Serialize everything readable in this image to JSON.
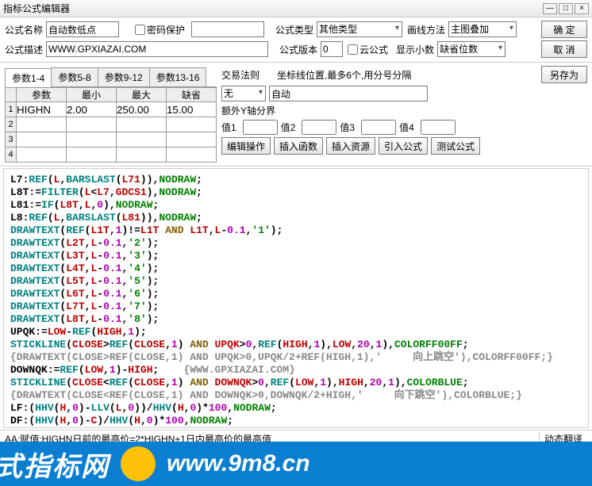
{
  "window": {
    "title": "指标公式编辑器",
    "min": "—",
    "max": "□",
    "close": "×"
  },
  "form": {
    "name_lbl": "公式名称",
    "name_val": "自动数低点",
    "pwd_lbl": "密码保护",
    "type_lbl": "公式类型",
    "type_val": "其他类型",
    "draw_lbl": "画线方法",
    "draw_val": "主图叠加",
    "ok": "确  定",
    "desc_lbl": "公式描述",
    "desc_val": "WWW.GPXIAZAI.COM",
    "ver_lbl": "公式版本",
    "ver_val": "0",
    "cloud_lbl": "云公式",
    "dec_lbl": "显示小数",
    "dec_val": "缺省位数",
    "cancel": "取  消"
  },
  "tabs": [
    "参数1-4",
    "参数5-8",
    "参数9-12",
    "参数13-16"
  ],
  "param_headers": [
    "参数",
    "最小",
    "最大",
    "缺省"
  ],
  "param_rows": [
    [
      "HIGHN",
      "2.00",
      "250.00",
      "15.00"
    ],
    [
      "",
      "",
      "",
      ""
    ],
    [
      "",
      "",
      "",
      ""
    ],
    [
      "",
      "",
      "",
      ""
    ]
  ],
  "right": {
    "trade_lbl": "交易法则",
    "coord_lbl": "坐标线位置,最多6个,用分号分隔",
    "saveas": "另存为",
    "none_val": "无",
    "auto_val": "自动",
    "extra_y_lbl": "额外Y轴分界",
    "val_lbls": [
      "值1",
      "值2",
      "值3",
      "值4"
    ],
    "toolbar": [
      "编辑操作",
      "插入函数",
      "插入资源",
      "引入公式",
      "测试公式"
    ]
  },
  "status": {
    "left": "AA:赋值:HIGHN日前的最高价=2*HIGHN+1日内最高价的最高值",
    "right": "动态翻译"
  },
  "banner": {
    "zh": "式指标网",
    "url": "www.9m8.cn"
  },
  "code_lines": [
    [
      [
        "L7",
        0
      ],
      [
        ":",
        0
      ],
      [
        "REF",
        1
      ],
      [
        "(",
        0
      ],
      [
        "L",
        2
      ],
      [
        ",",
        0
      ],
      [
        "BARSLAST",
        1
      ],
      [
        "(",
        0
      ],
      [
        "L71",
        2
      ],
      [
        ")",
        0
      ],
      [
        ")",
        0
      ],
      [
        ",",
        0
      ],
      [
        "NODRAW",
        3
      ],
      [
        ";",
        0
      ]
    ],
    [
      [
        "L8T",
        0
      ],
      [
        ":=",
        0
      ],
      [
        "FILTER",
        1
      ],
      [
        "(",
        0
      ],
      [
        "L",
        2
      ],
      [
        "<",
        0
      ],
      [
        "L7",
        2
      ],
      [
        ",",
        0
      ],
      [
        "GDCS1",
        2
      ],
      [
        ")",
        0
      ],
      [
        ",",
        0
      ],
      [
        "NODRAW",
        3
      ],
      [
        ";",
        0
      ]
    ],
    [
      [
        "L81",
        0
      ],
      [
        ":=",
        0
      ],
      [
        "IF",
        1
      ],
      [
        "(",
        0
      ],
      [
        "L8T",
        2
      ],
      [
        ",",
        0
      ],
      [
        "L",
        2
      ],
      [
        ",",
        0
      ],
      [
        "0",
        4
      ],
      [
        ")",
        0
      ],
      [
        ",",
        0
      ],
      [
        "NODRAW",
        3
      ],
      [
        ";",
        0
      ]
    ],
    [
      [
        "L8",
        0
      ],
      [
        ":",
        0
      ],
      [
        "REF",
        1
      ],
      [
        "(",
        0
      ],
      [
        "L",
        2
      ],
      [
        ",",
        0
      ],
      [
        "BARSLAST",
        1
      ],
      [
        "(",
        0
      ],
      [
        "L81",
        2
      ],
      [
        ")",
        0
      ],
      [
        ")",
        0
      ],
      [
        ",",
        0
      ],
      [
        "NODRAW",
        3
      ],
      [
        ";",
        0
      ]
    ],
    [
      [
        "DRAWTEXT",
        1
      ],
      [
        "(",
        0
      ],
      [
        "REF",
        1
      ],
      [
        "(",
        0
      ],
      [
        "L1T",
        2
      ],
      [
        ",",
        0
      ],
      [
        "1",
        4
      ],
      [
        ")",
        0
      ],
      [
        "!=",
        0
      ],
      [
        "L1T",
        2
      ],
      [
        " AND ",
        5
      ],
      [
        "L1T",
        2
      ],
      [
        ",",
        0
      ],
      [
        "L",
        2
      ],
      [
        "-",
        0
      ],
      [
        "0.1",
        4
      ],
      [
        ",",
        0
      ],
      [
        "'1'",
        3
      ],
      [
        ");",
        0
      ]
    ],
    [
      [
        "DRAWTEXT",
        1
      ],
      [
        "(",
        0
      ],
      [
        "L2T",
        2
      ],
      [
        ",",
        0
      ],
      [
        "L",
        2
      ],
      [
        "-",
        0
      ],
      [
        "0.1",
        4
      ],
      [
        ",",
        0
      ],
      [
        "'2'",
        3
      ],
      [
        ");",
        0
      ]
    ],
    [
      [
        "DRAWTEXT",
        1
      ],
      [
        "(",
        0
      ],
      [
        "L3T",
        2
      ],
      [
        ",",
        0
      ],
      [
        "L",
        2
      ],
      [
        "-",
        0
      ],
      [
        "0.1",
        4
      ],
      [
        ",",
        0
      ],
      [
        "'3'",
        3
      ],
      [
        ");",
        0
      ]
    ],
    [
      [
        "DRAWTEXT",
        1
      ],
      [
        "(",
        0
      ],
      [
        "L4T",
        2
      ],
      [
        ",",
        0
      ],
      [
        "L",
        2
      ],
      [
        "-",
        0
      ],
      [
        "0.1",
        4
      ],
      [
        ",",
        0
      ],
      [
        "'4'",
        3
      ],
      [
        ");",
        0
      ]
    ],
    [
      [
        "DRAWTEXT",
        1
      ],
      [
        "(",
        0
      ],
      [
        "L5T",
        2
      ],
      [
        ",",
        0
      ],
      [
        "L",
        2
      ],
      [
        "-",
        0
      ],
      [
        "0.1",
        4
      ],
      [
        ",",
        0
      ],
      [
        "'5'",
        3
      ],
      [
        ");",
        0
      ]
    ],
    [
      [
        "DRAWTEXT",
        1
      ],
      [
        "(",
        0
      ],
      [
        "L6T",
        2
      ],
      [
        ",",
        0
      ],
      [
        "L",
        2
      ],
      [
        "-",
        0
      ],
      [
        "0.1",
        4
      ],
      [
        ",",
        0
      ],
      [
        "'6'",
        3
      ],
      [
        ");",
        0
      ]
    ],
    [
      [
        "DRAWTEXT",
        1
      ],
      [
        "(",
        0
      ],
      [
        "L7T",
        2
      ],
      [
        ",",
        0
      ],
      [
        "L",
        2
      ],
      [
        "-",
        0
      ],
      [
        "0.1",
        4
      ],
      [
        ",",
        0
      ],
      [
        "'7'",
        3
      ],
      [
        ");",
        0
      ]
    ],
    [
      [
        "DRAWTEXT",
        1
      ],
      [
        "(",
        0
      ],
      [
        "L8T",
        2
      ],
      [
        ",",
        0
      ],
      [
        "L",
        2
      ],
      [
        "-",
        0
      ],
      [
        "0.1",
        4
      ],
      [
        ",",
        0
      ],
      [
        "'8'",
        3
      ],
      [
        ");",
        0
      ]
    ],
    [
      [
        "UPQK",
        0
      ],
      [
        ":=",
        0
      ],
      [
        "LOW",
        2
      ],
      [
        "-",
        0
      ],
      [
        "REF",
        1
      ],
      [
        "(",
        0
      ],
      [
        "HIGH",
        2
      ],
      [
        ",",
        0
      ],
      [
        "1",
        4
      ],
      [
        ");",
        0
      ]
    ],
    [
      [
        "STICKLINE",
        1
      ],
      [
        "(",
        0
      ],
      [
        "CLOSE",
        2
      ],
      [
        ">",
        0
      ],
      [
        "REF",
        1
      ],
      [
        "(",
        0
      ],
      [
        "CLOSE",
        2
      ],
      [
        ",",
        0
      ],
      [
        "1",
        4
      ],
      [
        ")",
        0
      ],
      [
        " AND ",
        5
      ],
      [
        "UPQK",
        2
      ],
      [
        ">",
        0
      ],
      [
        "0",
        4
      ],
      [
        ",",
        0
      ],
      [
        "REF",
        1
      ],
      [
        "(",
        0
      ],
      [
        "HIGH",
        2
      ],
      [
        ",",
        0
      ],
      [
        "1",
        4
      ],
      [
        ")",
        0
      ],
      [
        ",",
        0
      ],
      [
        "LOW",
        2
      ],
      [
        ",",
        0
      ],
      [
        "20",
        4
      ],
      [
        ",",
        0
      ],
      [
        "1",
        4
      ],
      [
        ")",
        0
      ],
      [
        ",",
        0
      ],
      [
        "COLORFF00FF",
        3
      ],
      [
        ";",
        0
      ]
    ],
    [
      [
        "{DRAWTEXT(CLOSE>REF(CLOSE,1) AND UPQK>0,UPQK/2+REF(HIGH,1),'     向上跳空'),COLORFF00FF;}",
        6
      ]
    ],
    [
      [
        "DOWNQK",
        0
      ],
      [
        ":=",
        0
      ],
      [
        "REF",
        1
      ],
      [
        "(",
        0
      ],
      [
        "LOW",
        2
      ],
      [
        ",",
        0
      ],
      [
        "1",
        4
      ],
      [
        ")",
        0
      ],
      [
        "-",
        0
      ],
      [
        "HIGH",
        2
      ],
      [
        ";",
        0
      ],
      [
        "    {WWW.GPXIAZAI.COM}",
        6
      ]
    ],
    [
      [
        "STICKLINE",
        1
      ],
      [
        "(",
        0
      ],
      [
        "CLOSE",
        2
      ],
      [
        "<",
        0
      ],
      [
        "REF",
        1
      ],
      [
        "(",
        0
      ],
      [
        "CLOSE",
        2
      ],
      [
        ",",
        0
      ],
      [
        "1",
        4
      ],
      [
        ")",
        0
      ],
      [
        " AND ",
        5
      ],
      [
        "DOWNQK",
        2
      ],
      [
        ">",
        0
      ],
      [
        "0",
        4
      ],
      [
        ",",
        0
      ],
      [
        "REF",
        1
      ],
      [
        "(",
        0
      ],
      [
        "LOW",
        2
      ],
      [
        ",",
        0
      ],
      [
        "1",
        4
      ],
      [
        ")",
        0
      ],
      [
        ",",
        0
      ],
      [
        "HIGH",
        2
      ],
      [
        ",",
        0
      ],
      [
        "20",
        4
      ],
      [
        ",",
        0
      ],
      [
        "1",
        4
      ],
      [
        ")",
        0
      ],
      [
        ",",
        0
      ],
      [
        "COLORBLUE",
        3
      ],
      [
        ";",
        0
      ]
    ],
    [
      [
        "{DRAWTEXT(CLOSE<REF(CLOSE,1) AND DOWNQK>0,DOWNQK/2+HIGH,'     向下跳空'),COLORBLUE;}",
        6
      ]
    ],
    [
      [
        "LF",
        0
      ],
      [
        ":",
        0
      ],
      [
        "(",
        0
      ],
      [
        "HHV",
        1
      ],
      [
        "(",
        0
      ],
      [
        "H",
        2
      ],
      [
        ",",
        0
      ],
      [
        "0",
        4
      ],
      [
        ")",
        0
      ],
      [
        "-",
        0
      ],
      [
        "LLV",
        1
      ],
      [
        "(",
        0
      ],
      [
        "L",
        2
      ],
      [
        ",",
        0
      ],
      [
        "0",
        4
      ],
      [
        "))",
        0
      ],
      [
        "/",
        0
      ],
      [
        "HHV",
        1
      ],
      [
        "(",
        0
      ],
      [
        "H",
        2
      ],
      [
        ",",
        0
      ],
      [
        "0",
        4
      ],
      [
        ")",
        0
      ],
      [
        "*",
        0
      ],
      [
        "100",
        4
      ],
      [
        ",",
        0
      ],
      [
        "NODRAW",
        3
      ],
      [
        ";",
        0
      ]
    ],
    [
      [
        "DF",
        0
      ],
      [
        ":",
        0
      ],
      [
        "(",
        0
      ],
      [
        "HHV",
        1
      ],
      [
        "(",
        0
      ],
      [
        "H",
        2
      ],
      [
        ",",
        0
      ],
      [
        "0",
        4
      ],
      [
        ")",
        0
      ],
      [
        "-",
        0
      ],
      [
        "C",
        2
      ],
      [
        ")",
        0
      ],
      [
        "/",
        0
      ],
      [
        "HHV",
        1
      ],
      [
        "(",
        0
      ],
      [
        "H",
        2
      ],
      [
        ",",
        0
      ],
      [
        "0",
        4
      ],
      [
        ")",
        0
      ],
      [
        "*",
        0
      ],
      [
        "100",
        4
      ],
      [
        ",",
        0
      ],
      [
        "NODRAW",
        3
      ],
      [
        ";",
        0
      ]
    ]
  ],
  "color_map": [
    "c-blk",
    "c-teal",
    "c-red",
    "c-grn",
    "c-mag",
    "c-brn",
    "c-gry"
  ]
}
